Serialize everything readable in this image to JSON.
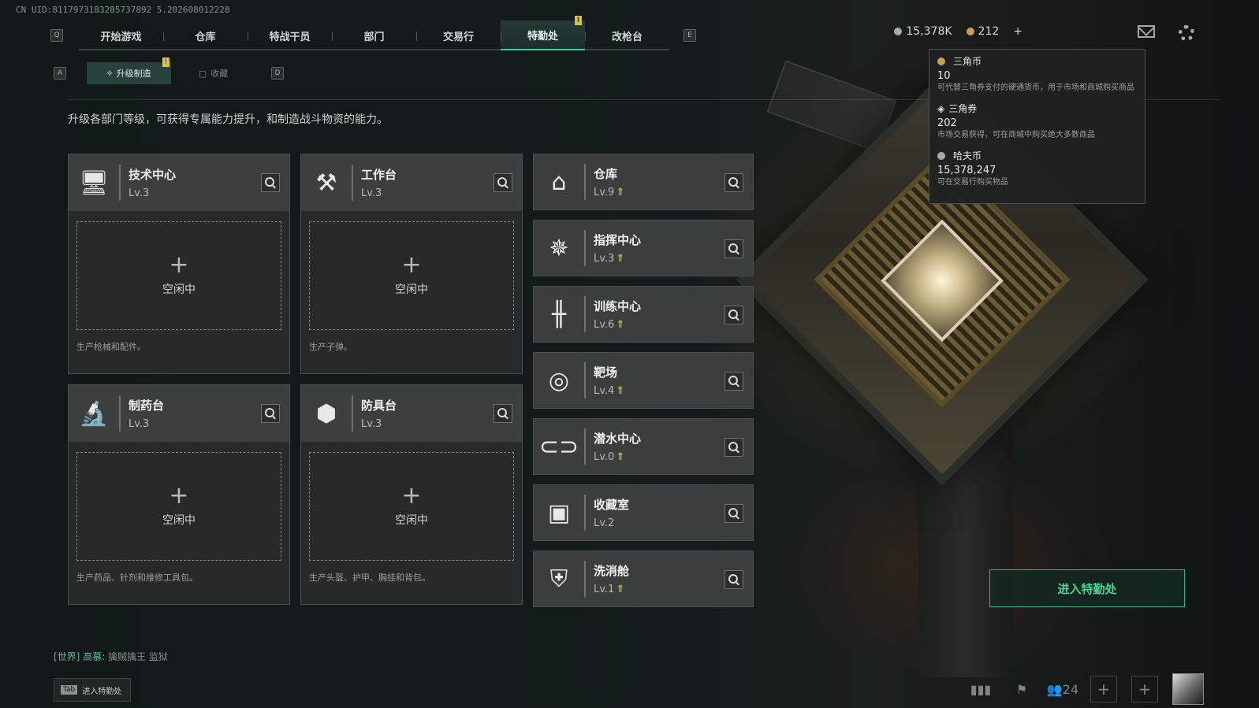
{
  "uid": "CN UID:8117973183285737892 5.202608012228",
  "nav": {
    "left_key": "Q",
    "right_key": "E",
    "tabs": [
      "开始游戏",
      "仓库",
      "特战干员",
      "部门",
      "交易行",
      "特勤处",
      "改枪台"
    ],
    "active_tab": "特勤处",
    "active_mark": "!"
  },
  "subnav": {
    "left_key": "A",
    "right_key": "D",
    "tabs": [
      "升级制造",
      "收藏"
    ],
    "active_mark": "!"
  },
  "currency": {
    "haf_short": "15,378K",
    "triangle_coin": "212",
    "add": "+"
  },
  "description": "升级各部门等级，可获得专属能力提升，和制造战斗物资的能力。",
  "production_cards": [
    {
      "name": "技术中心",
      "level": "Lv.3",
      "icon": "computer-icon",
      "slot_plus": "+",
      "slot_label": "空闲中",
      "note": "生产枪械和配件。"
    },
    {
      "name": "工作台",
      "level": "Lv.3",
      "icon": "hammer-wrench-icon",
      "slot_plus": "+",
      "slot_label": "空闲中",
      "note": "生产子弹。"
    },
    {
      "name": "制药台",
      "level": "Lv.3",
      "icon": "microscope-icon",
      "slot_plus": "+",
      "slot_label": "空闲中",
      "note": "生产药品、针剂和维修工具包。"
    },
    {
      "name": "防具台",
      "level": "Lv.3",
      "icon": "cubes-icon",
      "slot_plus": "+",
      "slot_label": "空闲中",
      "note": "生产头盔、护甲、胸挂和背包。"
    }
  ],
  "departments": [
    {
      "name": "仓库",
      "level": "Lv.9",
      "upgradable": true,
      "icon": "warehouse-icon"
    },
    {
      "name": "指挥中心",
      "level": "Lv.3",
      "upgradable": true,
      "icon": "command-icon"
    },
    {
      "name": "训练中心",
      "level": "Lv.6",
      "upgradable": true,
      "icon": "dumbbell-icon"
    },
    {
      "name": "靶场",
      "level": "Lv.4",
      "upgradable": true,
      "icon": "target-icon"
    },
    {
      "name": "潜水中心",
      "level": "Lv.0",
      "upgradable": true,
      "icon": "diving-mask-icon"
    },
    {
      "name": "收藏室",
      "level": "Lv.2",
      "upgradable": false,
      "icon": "collection-icon"
    },
    {
      "name": "洗消舱",
      "level": "Lv.1",
      "upgradable": true,
      "icon": "decon-icon"
    }
  ],
  "tooltip": [
    {
      "name": "三角币",
      "value": "10",
      "note": "可代替三角券支付的硬通货币，用于市场和商城购买商品"
    },
    {
      "name": "三角券",
      "value": "202",
      "note": "市场交易获得，可在商城中购买绝大多数商品"
    },
    {
      "name": "哈夫币",
      "value": "15,378,247",
      "note": "可在交易行购买物品"
    }
  ],
  "enter_button": "进入特勤处",
  "chat": {
    "channel": "[世界]",
    "sender": "高慕:",
    "message": "擒贼擒王 监狱"
  },
  "hint": {
    "key": "Tab",
    "label": "进入特勤处"
  },
  "bottom": {
    "friends_count": "24"
  },
  "colors": {
    "accent": "#49d49a",
    "upgrade": "#d9b44a",
    "mark": "#d8c24a"
  }
}
